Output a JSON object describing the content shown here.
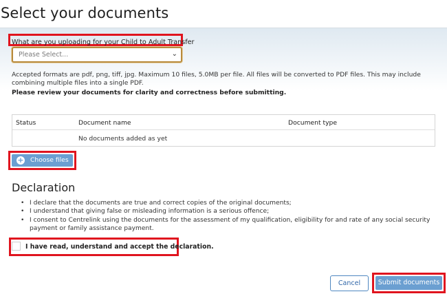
{
  "page": {
    "title": "Select your documents"
  },
  "upload": {
    "label": "What are you uploading for your Child to Adult Transfer",
    "select_value": "Please Select...",
    "formats_text": "Accepted formats are pdf, png, tiff, jpg. Maximum 10 files, 5.0MB per file. All files will be converted to PDF files. This may include combining multiple files into a single PDF.",
    "review_text": "Please review your documents for clarity and correctness before submitting."
  },
  "table": {
    "headers": [
      "Status",
      "Document name",
      "Document type"
    ],
    "empty_text": "No documents added as yet"
  },
  "choose_files": {
    "label": "Choose files",
    "icon": "plus-circle-icon"
  },
  "declaration": {
    "title": "Declaration",
    "items": [
      "I declare that the documents are true and correct copies of the original documents;",
      "I understand that giving false or misleading information is a serious offence;",
      "I consent to Centrelink using the documents for the assessment of my qualification, eligibility for and rate of any social security payment or family assistance payment."
    ],
    "accept_label": "I have read, understand and accept the declaration."
  },
  "actions": {
    "cancel": "Cancel",
    "submit": "Submit documents"
  },
  "colors": {
    "accent": "#6b9fd1",
    "highlight": "#e0141e",
    "link": "#2f66a8"
  }
}
